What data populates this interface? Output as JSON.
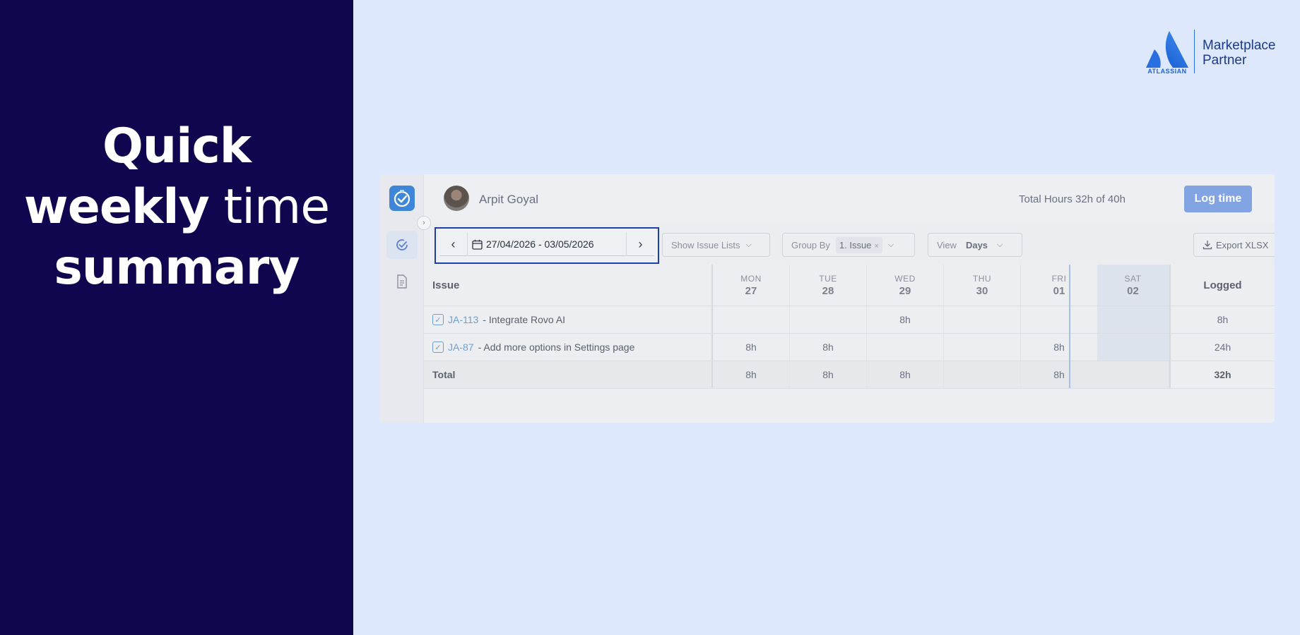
{
  "headline": {
    "line1": "Quick",
    "line2_bold": "weekly",
    "line2_light": " time",
    "line3": "summary"
  },
  "partner": {
    "brand": "ATLASSIAN",
    "line1": "Marketplace",
    "line2": "Partner"
  },
  "header": {
    "user_name": "Arpit Goyal",
    "total_hours": "Total Hours 32h of 40h",
    "log_button": "Log time"
  },
  "toolbar": {
    "date_range": "27/04/2026 - 03/05/2026",
    "show_issue_lists": "Show Issue Lists",
    "group_by_label": "Group By",
    "group_by_value": "1. Issue",
    "view_label": "View",
    "view_value": "Days",
    "export_label": "Export XLSX"
  },
  "table": {
    "issue_header": "Issue",
    "logged_header": "Logged",
    "days": [
      {
        "name": "MON",
        "num": "27"
      },
      {
        "name": "TUE",
        "num": "28"
      },
      {
        "name": "WED",
        "num": "29"
      },
      {
        "name": "THU",
        "num": "30"
      },
      {
        "name": "FRI",
        "num": "01"
      },
      {
        "name": "SAT",
        "num": "02"
      }
    ],
    "rows": [
      {
        "key": "JA-113",
        "title": "- Integrate Rovo AI",
        "hours": [
          "",
          "",
          "8h",
          "",
          "",
          ""
        ],
        "logged": "8h"
      },
      {
        "key": "JA-87",
        "title": "- Add more options in Settings page",
        "hours": [
          "8h",
          "8h",
          "",
          "",
          "8h",
          ""
        ],
        "logged": "24h"
      }
    ],
    "total": {
      "label": "Total",
      "hours": [
        "8h",
        "8h",
        "8h",
        "",
        "8h",
        ""
      ],
      "logged": "32h"
    }
  },
  "colors": {
    "navy": "#10054f",
    "background": "#dde8fd",
    "accent": "#82a4e2",
    "highlight_border": "#1f3fa8"
  }
}
